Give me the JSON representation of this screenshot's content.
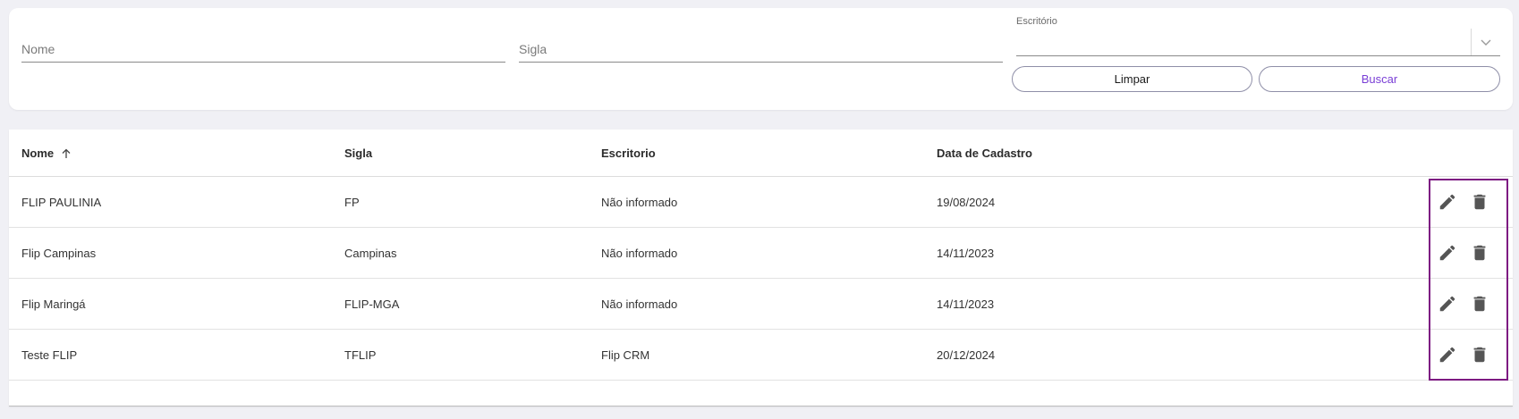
{
  "filters": {
    "nome_placeholder": "Nome",
    "sigla_placeholder": "Sigla",
    "escritorio_label": "Escritório",
    "escritorio_value": "",
    "limpar_label": "Limpar",
    "buscar_label": "Buscar"
  },
  "table": {
    "columns": {
      "nome": "Nome",
      "sigla": "Sigla",
      "escritorio": "Escritorio",
      "data_cadastro": "Data de Cadastro"
    },
    "sort": {
      "column": "nome",
      "direction": "asc",
      "icon": "arrow-up-icon"
    },
    "rows": [
      {
        "nome": "FLIP PAULINIA",
        "sigla": "FP",
        "escritorio": "Não informado",
        "data": "19/08/2024"
      },
      {
        "nome": "Flip Campinas",
        "sigla": "Campinas",
        "escritorio": "Não informado",
        "data": "14/11/2023"
      },
      {
        "nome": "Flip Maringá",
        "sigla": "FLIP-MGA",
        "escritorio": "Não informado",
        "data": "14/11/2023"
      },
      {
        "nome": "Teste FLIP",
        "sigla": "TFLIP",
        "escritorio": "Flip CRM",
        "data": "20/12/2024"
      }
    ],
    "row_actions": [
      "pencil-icon",
      "trash-icon"
    ]
  },
  "colors": {
    "accent": "#7a3fd6",
    "highlight": "#7d1a82",
    "icon": "#555555"
  }
}
